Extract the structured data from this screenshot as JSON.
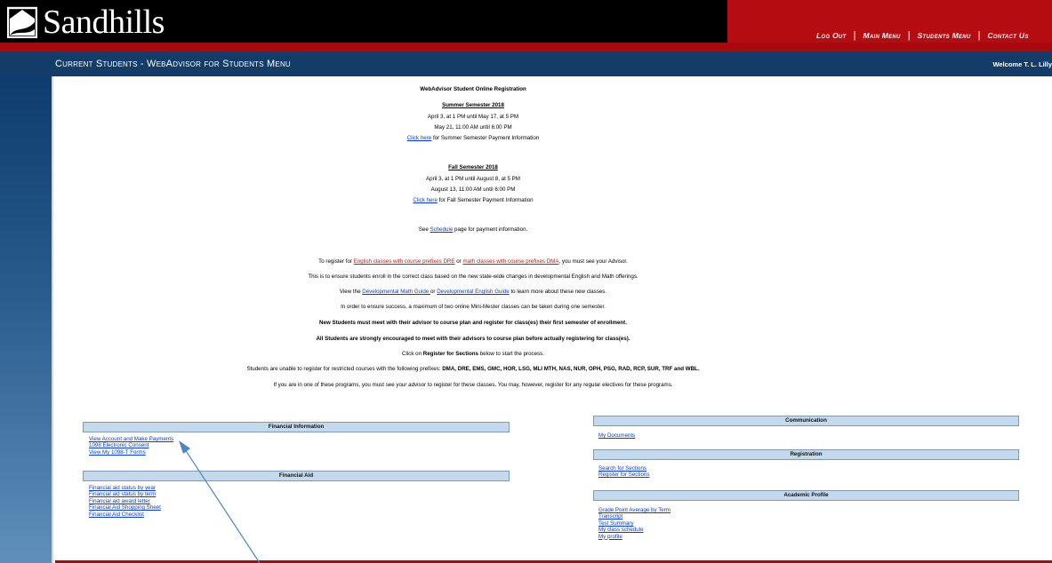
{
  "header": {
    "logo_text": "Sandhills",
    "nav": [
      "Log Out",
      "Main Menu",
      "Students Menu",
      "Contact Us"
    ],
    "nav_sep": "|"
  },
  "title_bar": {
    "title": "Current Students - WebAdvisor for Students Menu",
    "welcome": "Welcome T. L. Lilly"
  },
  "announcement": {
    "heading": "WebAdvisor Student Online Registration",
    "summer_title": "Summer Semester 2018",
    "summer_line1": "April 3, at 1 PM until May 17, at 5 PM",
    "summer_line2": "May 21, 11:00 AM until 6:00 PM",
    "summer_payment_link": "Click here",
    "summer_payment_text": " for Summer Semester Payment Information",
    "fall_title": "Fall Semester 2018",
    "fall_line1": "April 3, at 1 PM until August 8, at 5 PM",
    "fall_line2": "August 13, 11:00 AM until 6:00 PM",
    "fall_payment_link": "Click here",
    "fall_payment_text": " for Fall Semester Payment Information",
    "schedule_pre": "See ",
    "schedule_link": "Schedule",
    "schedule_post": " page for payment information.",
    "register_pre": "To register for ",
    "register_link1": "English classes with course prefixes DRE",
    "register_mid": " or ",
    "register_link2": "math classes with course prefixes DMA",
    "register_post": ", you must see your Advisor.",
    "ensure_line": "This is to ensure students enroll in the correct class based on the new state-wide changes in developmental English and Math offerings.",
    "view_pre": "View the ",
    "view_link1": "Developmental Math Guide ",
    "view_mid": "or ",
    "view_link2": "Developmental English Guide",
    "view_post": " to learn more about these new classes.",
    "success_line": "In order to ensure success, a maximum of two online Mini-Mester classes can be taken during one semester.",
    "new_students_line": "New Students must meet with their advisor to course plan and register for class(es) their first semester of enrollment.",
    "all_students_line": "All Students are strongly encouraged to meet with their advisors to course plan before actually registering for class(es).",
    "click_pre": "Click on ",
    "click_bold": "Register for Sections",
    "click_post": " below to start the process.",
    "restricted_pre": "Students are unable to register for restricted courses with the following prefixes: ",
    "restricted_bold": "DMA, DRE, EMS, GMC, HOR, LSG, MLI MTH, NAS, NUR, OPH, PSG, RAD, RCP, SUR, TRF and WBL.",
    "programs_line": "If you are in one of these programs, you must see your advisor to register for these classes. You may, however, register for any regular electives for these programs."
  },
  "panels": {
    "financial_info": {
      "title": "Financial Information",
      "links": [
        "View Account and Make Payments",
        "1098 Electronic Consent",
        "View My 1098-T Forms"
      ]
    },
    "financial_aid": {
      "title": "Financial Aid",
      "links": [
        "Financial aid status by year",
        "Financial aid status by term",
        "Financial aid award letter",
        "Financial Aid Shopping Sheet",
        "Financial Aid Checklist"
      ]
    },
    "communication": {
      "title": "Communication",
      "links": [
        "My Documents"
      ]
    },
    "registration": {
      "title": "Registration",
      "links": [
        "Search for Sections",
        "Register for Sections"
      ]
    },
    "academic_profile": {
      "title": "Academic Profile",
      "links": [
        "Grade Point Average by Term",
        "Transcript",
        "Test Summary",
        "My class schedule",
        "My profile"
      ]
    }
  },
  "colors": {
    "header_black": "#000000",
    "header_red": "#b40c11",
    "title_bar": "#133d68",
    "panel_header": "#c4d9ec",
    "link": "#0b3cc8",
    "red_link": "#d01010",
    "annotation_arrow": "#4f86c0"
  },
  "icons": {
    "logo": "sandhills-logo-icon",
    "annotation": "annotation-arrow-icon"
  }
}
